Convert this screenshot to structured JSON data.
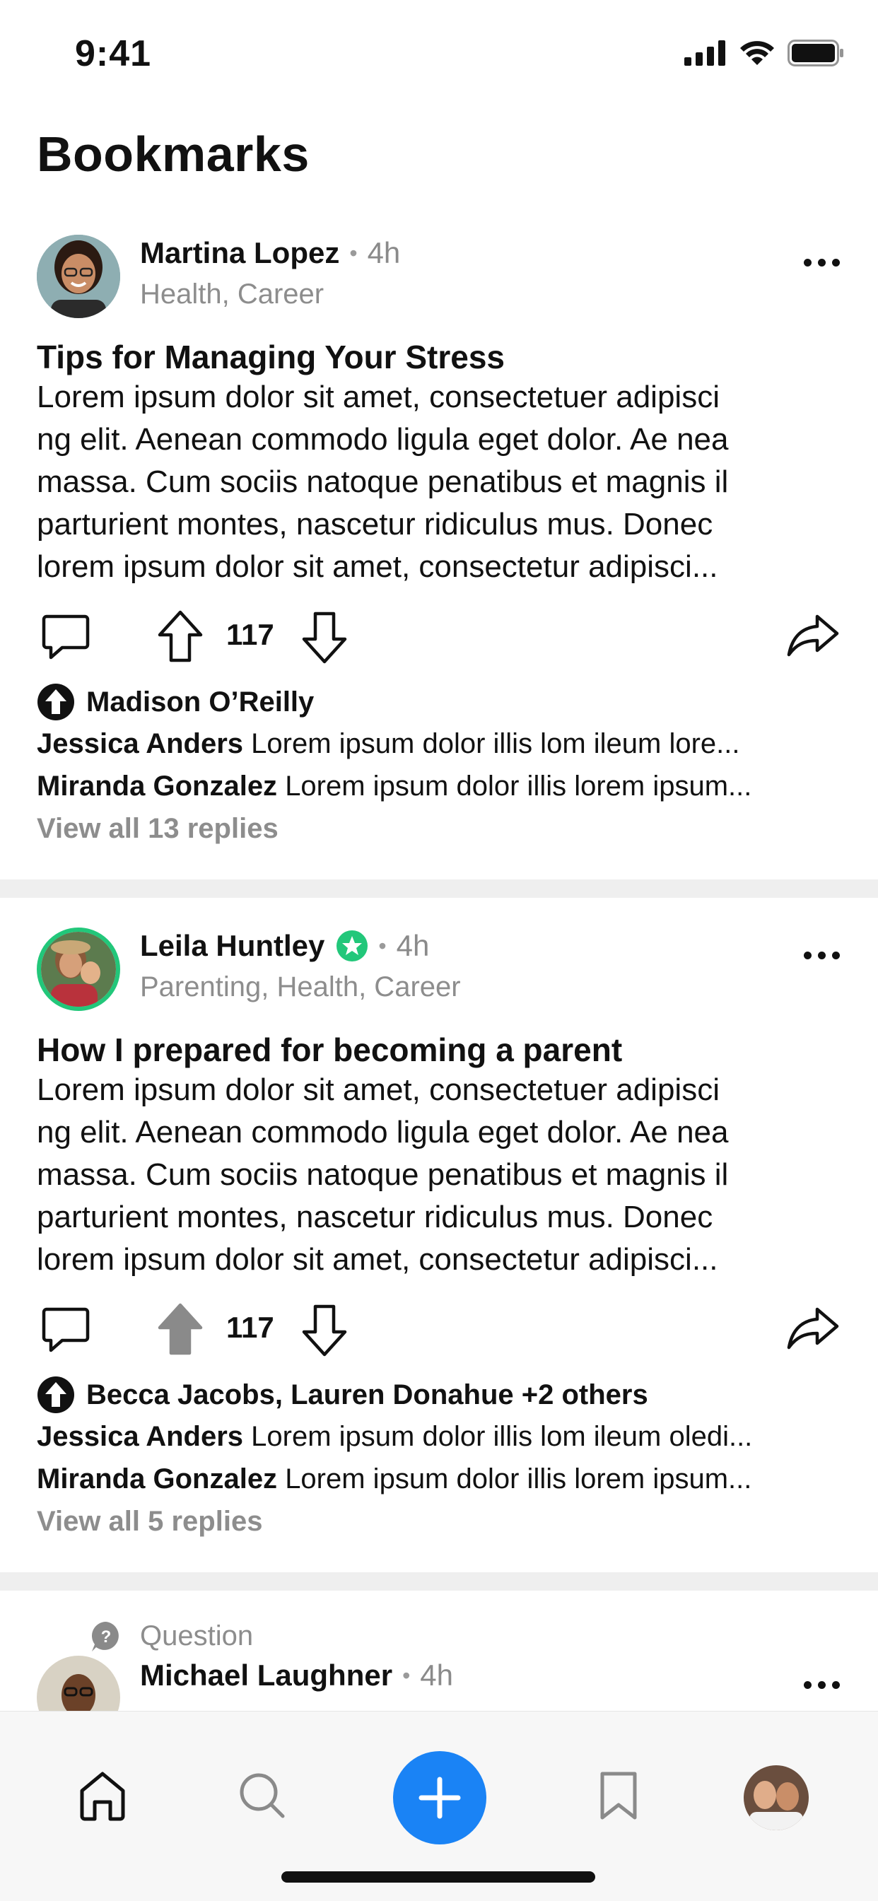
{
  "status": {
    "time": "9:41"
  },
  "page": {
    "title": "Bookmarks"
  },
  "posts": [
    {
      "author": "Martina Lopez",
      "time": "4h",
      "topics": "Health, Career",
      "title": "Tips for Managing Your Stress",
      "body": [
        "Lorem ipsum dolor sit amet, consectetuer adipisci",
        "ng elit. Aenean commodo ligula eget dolor. Ae nea",
        "massa. Cum sociis natoque penatibus et magnis il",
        "parturient montes, nascetur ridiculus mus. Donec",
        "lorem ipsum dolor sit amet, consectetur adipisci..."
      ],
      "votes": "117",
      "upvoted_by": "Madison O’Reilly",
      "replies": [
        {
          "name": "Jessica Anders",
          "text": "Lorem ipsum dolor illis lom ileum lore..."
        },
        {
          "name": "Miranda Gonzalez",
          "text": "Lorem ipsum dolor illis lorem ipsum..."
        }
      ],
      "view_all": "View all 13 replies"
    },
    {
      "author": "Leila Huntley",
      "time": "4h",
      "topics": "Parenting, Health, Career",
      "title": "How I prepared for becoming a parent",
      "body": [
        "Lorem ipsum dolor sit amet, consectetuer adipisci",
        "ng elit. Aenean commodo ligula eget dolor. Ae nea",
        "massa. Cum sociis natoque penatibus et magnis il",
        "parturient montes, nascetur ridiculus mus. Donec",
        "lorem ipsum dolor sit amet, consectetur adipisci..."
      ],
      "votes": "117",
      "upvoted_by": "Becca Jacobs, Lauren Donahue +2 others",
      "replies": [
        {
          "name": "Jessica Anders",
          "text": "Lorem ipsum dolor illis lom ileum oledi..."
        },
        {
          "name": "Miranda Gonzalez",
          "text": "Lorem ipsum dolor illis lorem ipsum..."
        }
      ],
      "view_all": "View all 5 replies"
    },
    {
      "label": "Question",
      "author": "Michael Laughner",
      "time": "4h"
    }
  ],
  "colors": {
    "accent": "#1a83f5",
    "verified": "#22c77a"
  },
  "tabs": [
    "home-icon",
    "search-icon",
    "plus-icon",
    "bookmark-icon",
    "profile-avatar"
  ]
}
